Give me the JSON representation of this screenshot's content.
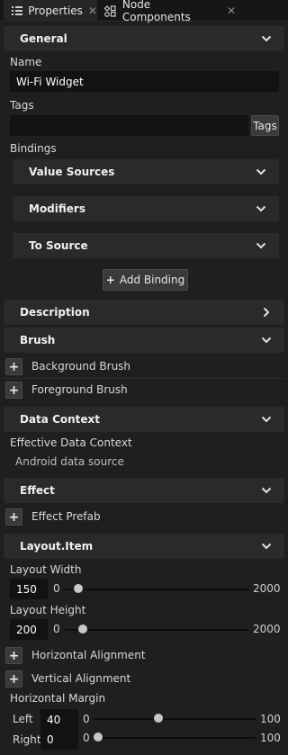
{
  "tabs": [
    {
      "label": "Properties",
      "icon": "list-icon"
    },
    {
      "label": "Node Components",
      "icon": "components-icon"
    }
  ],
  "general": {
    "title": "General",
    "name_label": "Name",
    "name_value": "Wi-Fi Widget",
    "tags_label": "Tags",
    "tags_value": "",
    "tags_button": "Tags",
    "bindings_label": "Bindings",
    "value_sources": "Value Sources",
    "modifiers": "Modifiers",
    "to_source": "To Source",
    "add_binding": "Add Binding"
  },
  "description": {
    "title": "Description"
  },
  "brush": {
    "title": "Brush",
    "background": "Background Brush",
    "foreground": "Foreground Brush"
  },
  "data_context": {
    "title": "Data Context",
    "effective_label": "Effective Data Context",
    "effective_value": "Android data source"
  },
  "effect": {
    "title": "Effect",
    "prefab": "Effect Prefab"
  },
  "layout": {
    "title": "Layout.Item",
    "width_label": "Layout Width",
    "width_value": "150",
    "width_min": "0",
    "width_max": "2000",
    "width_level": 0.075,
    "height_label": "Layout Height",
    "height_value": "200",
    "height_min": "0",
    "height_max": "2000",
    "height_level": 0.1,
    "h_align": "Horizontal Alignment",
    "v_align": "Vertical Alignment",
    "h_margin_label": "Horizontal Margin",
    "left_label": "Left",
    "left_value": "40",
    "left_min": "0",
    "left_max": "100",
    "left_level": 0.4,
    "right_label": "Right",
    "right_value": "0",
    "right_min": "0",
    "right_max": "100",
    "right_level": 0.0
  }
}
